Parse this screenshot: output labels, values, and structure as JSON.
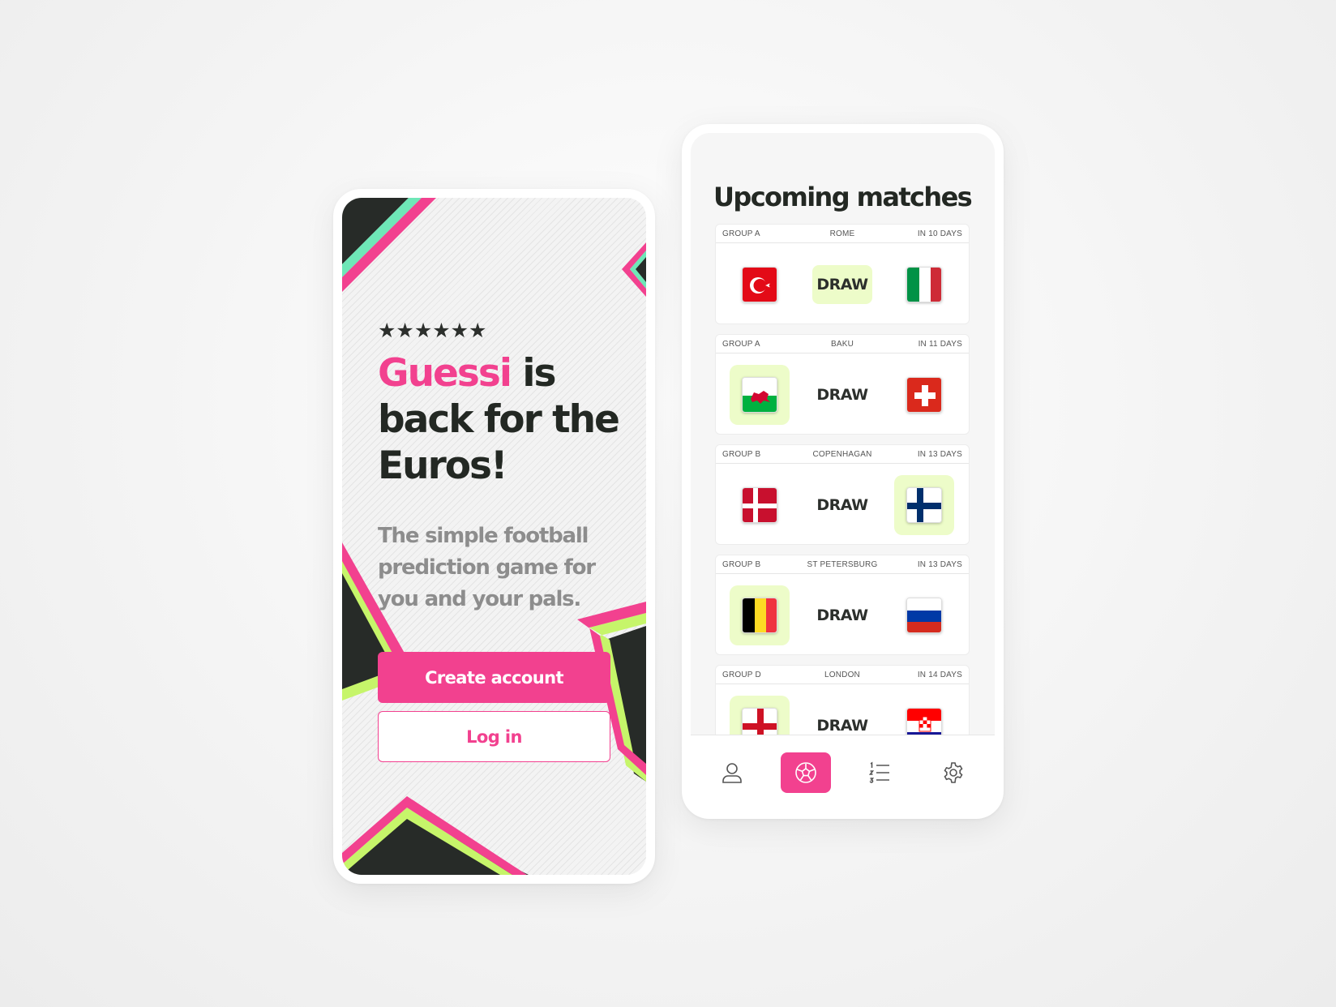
{
  "welcome": {
    "rating_stars": "★★★★★★",
    "title_brand": "Guessi",
    "title_rest": " is back for the Euros!",
    "subtitle": "The simple football prediction game for you and your pals.",
    "create_account_label": "Create account",
    "login_label": "Log in"
  },
  "matches": {
    "title": "Upcoming matches",
    "draw_label": "DRAW",
    "items": [
      {
        "group": "GROUP A",
        "city": "ROME",
        "when": "IN 10 DAYS",
        "home": "turkey-flag-icon",
        "away": "italy-flag-icon",
        "selected": "draw"
      },
      {
        "group": "GROUP A",
        "city": "BAKU",
        "when": "IN 11 DAYS",
        "home": "wales-flag-icon",
        "away": "switzerland-flag-icon",
        "selected": "home"
      },
      {
        "group": "GROUP B",
        "city": "COPENHAGAN",
        "when": "IN 13 DAYS",
        "home": "denmark-flag-icon",
        "away": "finland-flag-icon",
        "selected": "away"
      },
      {
        "group": "GROUP B",
        "city": "ST PETERSBURG",
        "when": "IN 13 DAYS",
        "home": "belgium-flag-icon",
        "away": "russia-flag-icon",
        "selected": "home"
      },
      {
        "group": "GROUP D",
        "city": "LONDON",
        "when": "IN 14 DAYS",
        "home": "england-flag-icon",
        "away": "croatia-flag-icon",
        "selected": "home"
      }
    ]
  },
  "nav": {
    "items": [
      "profile-icon",
      "football-icon",
      "leaderboard-icon",
      "settings-icon"
    ],
    "active": "football-icon"
  },
  "colors": {
    "accent": "#f2418f",
    "selected_bg": "#edfcc9",
    "dark": "#232823",
    "mint": "#6ee7b7",
    "lime": "#c6f56a"
  }
}
